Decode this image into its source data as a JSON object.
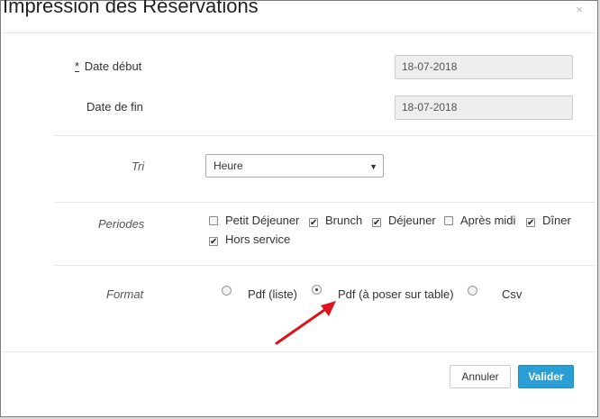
{
  "dialog": {
    "title": "Impression des Réservations",
    "close_glyph": "×"
  },
  "fields": {
    "date_debut": {
      "required_marker": "*",
      "label": "Date début",
      "value": "18-07-2018"
    },
    "date_fin": {
      "label": "Date de fin",
      "value": "18-07-2018"
    },
    "tri": {
      "label": "Tri",
      "selected": "Heure"
    },
    "periodes": {
      "label": "Periodes",
      "options": [
        {
          "label": "Petit Déjeuner",
          "checked": false
        },
        {
          "label": "Brunch",
          "checked": true
        },
        {
          "label": "Déjeuner",
          "checked": true
        },
        {
          "label": "Après midi",
          "checked": false
        },
        {
          "label": "Dîner",
          "checked": true
        },
        {
          "label": "Hors service",
          "checked": true
        }
      ]
    },
    "format": {
      "label": "Format",
      "options": [
        {
          "label": "Pdf (liste)",
          "selected": false
        },
        {
          "label": "Pdf (à poser sur table)",
          "selected": true
        },
        {
          "label": "Csv",
          "selected": false
        }
      ]
    }
  },
  "buttons": {
    "cancel": "Annuler",
    "ok": "Valider"
  },
  "colors": {
    "primary_button": "#2a9fd6",
    "annotation_arrow": "#e0121b"
  }
}
